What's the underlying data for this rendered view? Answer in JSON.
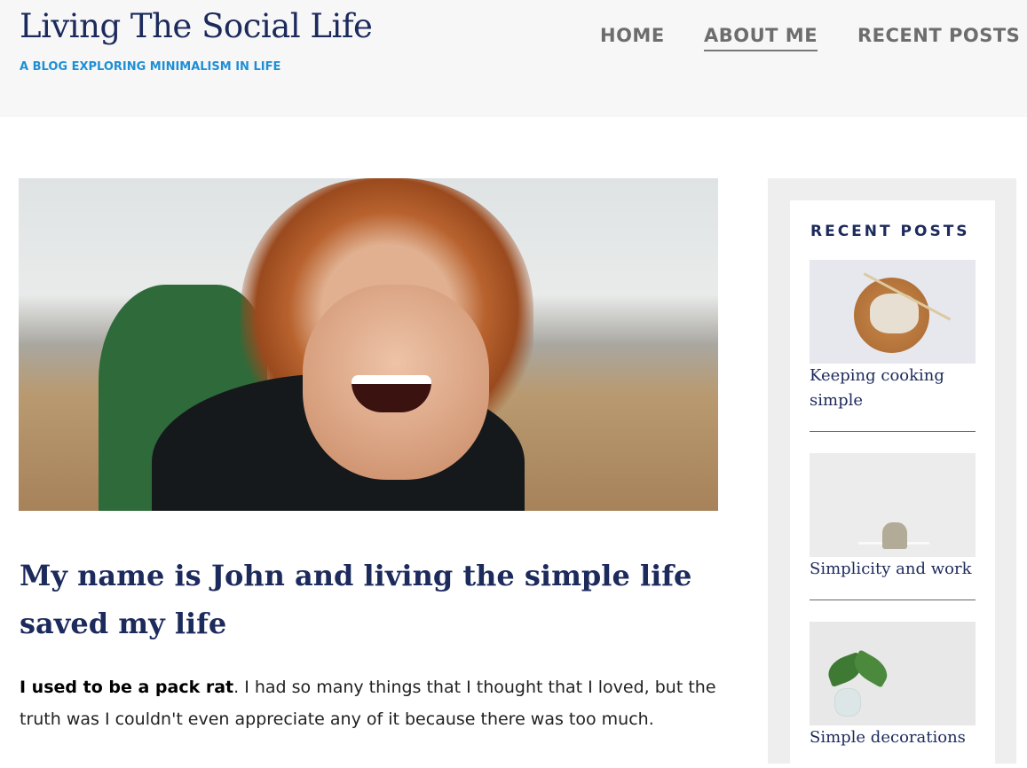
{
  "header": {
    "site_title": "Living The Social Life",
    "tagline": "A BLOG EXPLORING MINIMALISM IN LIFE",
    "nav": [
      {
        "label": "HOME",
        "active": false
      },
      {
        "label": "ABOUT ME",
        "active": true
      },
      {
        "label": "RECENT POSTS",
        "active": false
      }
    ]
  },
  "main": {
    "title": "My name is John and living the simple life saved my life",
    "intro_bold": "I used to be a pack rat",
    "intro_rest": ". I had so many things that I thought that I loved, but the truth was I couldn't even appreciate any of it because there was too much."
  },
  "sidebar": {
    "heading": "RECENT POSTS",
    "posts": [
      {
        "title": "Keeping cooking simple"
      },
      {
        "title": "Simplicity and work"
      },
      {
        "title": "Simple decorations"
      }
    ]
  }
}
